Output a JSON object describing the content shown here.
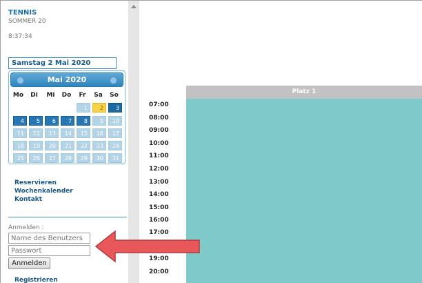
{
  "sidebar": {
    "club": "TENNIS",
    "season": "SOMMER 20",
    "clock": "8:37:34",
    "selected_date": "Samstag 2 Mai 2020",
    "calendar": {
      "title": "Mai 2020",
      "weekdays": [
        "Mo",
        "Di",
        "Mi",
        "Do",
        "Fr",
        "Sa",
        "So"
      ],
      "week1": [
        "1",
        "2",
        "3"
      ],
      "week2": [
        "4",
        "5",
        "6",
        "7",
        "8",
        "9",
        "10"
      ],
      "week3": [
        "11",
        "12",
        "13",
        "14",
        "15",
        "16",
        "17"
      ],
      "week4": [
        "18",
        "19",
        "20",
        "21",
        "22",
        "23",
        "24"
      ],
      "week5": [
        "25",
        "26",
        "27",
        "28",
        "29",
        "30",
        "31"
      ]
    },
    "links": [
      "Reservieren",
      "Wochenkalender",
      "Kontakt"
    ],
    "login": {
      "label": "Anmelden :",
      "user_placeholder": "Name des Benutzers",
      "pass_placeholder": "Passwort",
      "button": "Anmelden",
      "register": "Registrieren"
    }
  },
  "schedule": {
    "court": "Platz 1",
    "times": [
      "07:00",
      "08:00",
      "09:00",
      "10:00",
      "11:00",
      "12:00",
      "13:00",
      "14:00",
      "15:00",
      "16:00",
      "17:00",
      "19:00",
      "20:00"
    ]
  },
  "colors": {
    "accent": "#1a6fa5",
    "court": "#7ecac8",
    "today": "#f7d34b",
    "arrow": "#e8585a"
  }
}
